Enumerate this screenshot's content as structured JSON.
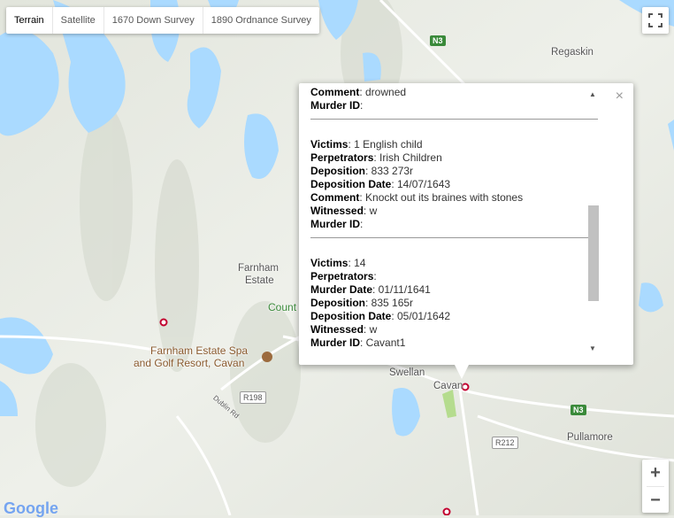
{
  "map_type_tabs": [
    "Terrain",
    "Satellite",
    "1670 Down Survey",
    "1890 Ordnance Survey"
  ],
  "active_tab": "Terrain",
  "place_labels": {
    "regaskin": "Regaskin",
    "farnham_estate": [
      "Farnham",
      "Estate"
    ],
    "county": "Count",
    "spa": [
      "Farnham Estate Spa",
      "and Golf Resort, Cavan"
    ],
    "swellan": "Swellan",
    "cavan": "Cavan",
    "pullamore": "Pullamore",
    "dublin_rd": "Dublin Rd"
  },
  "road_shields": {
    "n3_top": "N3",
    "n3_right": "N3",
    "r198": "R198",
    "r212": "R212"
  },
  "zoom": {
    "in": "+",
    "out": "−"
  },
  "brand": "Google",
  "infowindow": {
    "records": [
      {
        "lines": [
          {
            "label": "Comment",
            "value": ": drowned"
          },
          {
            "label": "Murder ID",
            "value": ":"
          }
        ]
      },
      {
        "lines": [
          {
            "label": "Victims",
            "value": ": 1 English child"
          },
          {
            "label": "Perpetrators",
            "value": ": Irish Children"
          },
          {
            "label": "Deposition",
            "value": ": 833 273r"
          },
          {
            "label": "Deposition Date",
            "value": ": 14/07/1643"
          },
          {
            "label": "Comment",
            "value": ": Knockt out its braines with stones"
          },
          {
            "label": "Witnessed",
            "value": ": w"
          },
          {
            "label": "Murder ID",
            "value": ":"
          }
        ]
      },
      {
        "lines": [
          {
            "label": "Victims",
            "value": ": 14"
          },
          {
            "label": "Perpetrators",
            "value": ":"
          },
          {
            "label": "Murder Date",
            "value": ": 01/11/1641"
          },
          {
            "label": "Deposition",
            "value": ": 835 165r"
          },
          {
            "label": "Deposition Date",
            "value": ": 05/01/1642"
          },
          {
            "label": "Witnessed",
            "value": ": w"
          },
          {
            "label": "Murder ID",
            "value": ": Cavant1"
          }
        ]
      }
    ],
    "close_glyph": "×"
  },
  "colors": {
    "water": "#8ab4f8",
    "land": "#e9ebe4",
    "marker": "#c2002f",
    "road": "#ffffff"
  }
}
